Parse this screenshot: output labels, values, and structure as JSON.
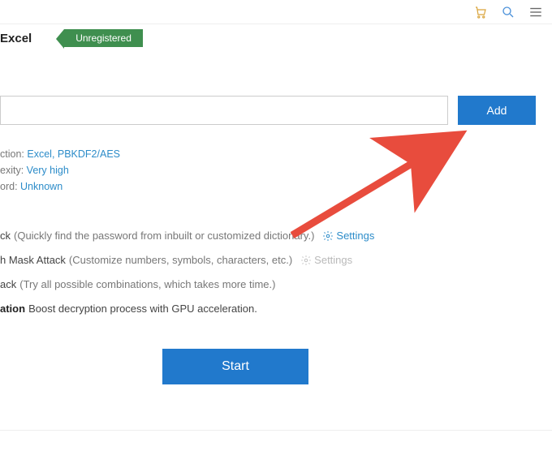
{
  "topbar": {
    "cart_icon": "cart-icon",
    "search_icon": "search-icon",
    "menu_icon": "menu-icon"
  },
  "header": {
    "title": "Excel",
    "badge": "Unregistered"
  },
  "file": {
    "input_value": "",
    "add_label": "Add"
  },
  "info": {
    "encryption_label": "ction:",
    "encryption_value": "Excel, PBKDF2/AES",
    "complexity_label": "exity:",
    "complexity_value": "Very high",
    "password_label": "ord:",
    "password_value": "Unknown"
  },
  "options": {
    "dict_suffix": "ck",
    "dict_paren": "(Quickly find the password from inbuilt or customized dictionary.)",
    "mask_suffix": "h Mask Attack",
    "mask_paren": "(Customize numbers, symbols, characters, etc.)",
    "brute_suffix": "ack",
    "brute_paren": "(Try all possible combinations, which takes more time.)",
    "gpu_bold": "ation",
    "gpu_rest": "Boost decryption process with GPU acceleration.",
    "settings_label": "Settings"
  },
  "actions": {
    "start_label": "Start"
  },
  "colors": {
    "accent": "#2179cc",
    "badge": "#3f8f4f",
    "link": "#2c8cc9",
    "arrow": "#e84c3d"
  }
}
